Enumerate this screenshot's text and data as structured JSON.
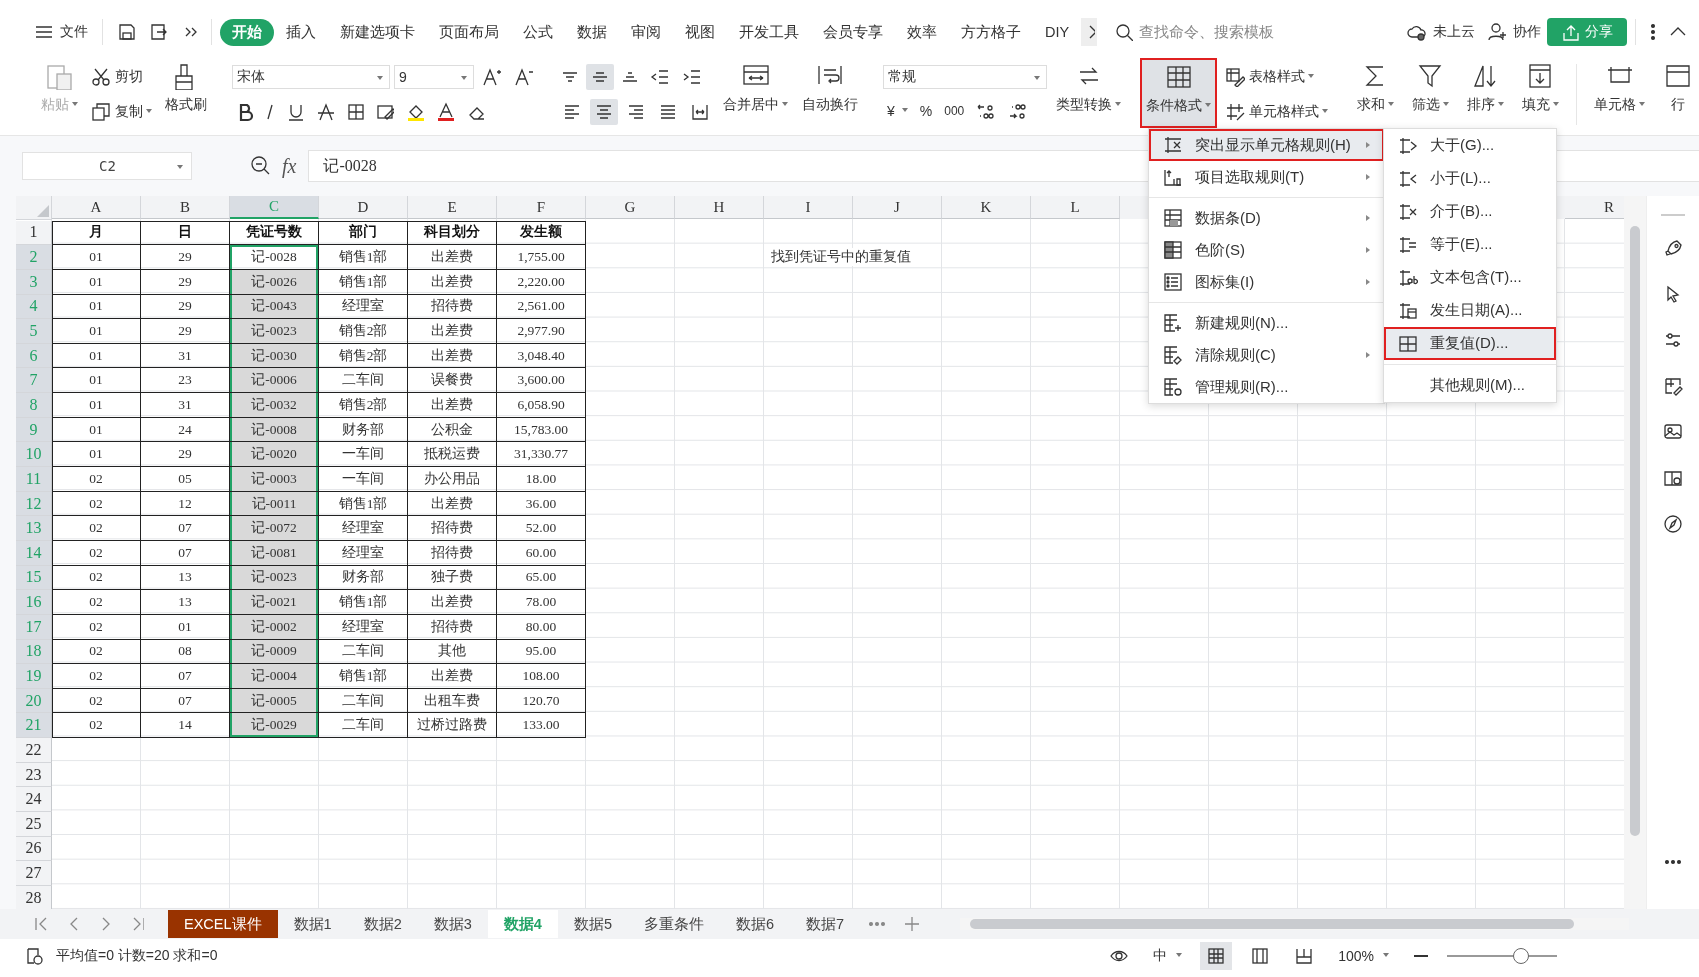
{
  "top_bar": {
    "file_menu": "文件",
    "tabs": [
      {
        "label": "开始",
        "selected": true
      },
      {
        "label": "插入",
        "selected": false
      },
      {
        "label": "新建选项卡",
        "selected": false
      },
      {
        "label": "页面布局",
        "selected": false
      },
      {
        "label": "公式",
        "selected": false
      },
      {
        "label": "数据",
        "selected": false
      },
      {
        "label": "审阅",
        "selected": false
      },
      {
        "label": "视图",
        "selected": false
      },
      {
        "label": "开发工具",
        "selected": false
      },
      {
        "label": "会员专享",
        "selected": false
      },
      {
        "label": "效率",
        "selected": false
      },
      {
        "label": "方方格子",
        "selected": false
      },
      {
        "label": "DIY",
        "selected": false
      }
    ],
    "search": {
      "placeholder": "查找命令、搜索模板"
    },
    "cloud": "未上云",
    "collaborate": "协作",
    "share": "分享"
  },
  "ribbon": {
    "clipboard": {
      "paste": {
        "label": "粘贴",
        "disabled": true,
        "dropdown": true
      },
      "cut": {
        "label": "剪切",
        "dropdown": false
      },
      "copy": {
        "label": "复制",
        "dropdown": true
      },
      "format_painter": {
        "label": "格式刷",
        "dropdown": false
      }
    },
    "font": {
      "name": "宋体",
      "size": "9"
    },
    "alignment": {
      "vertical": [
        {
          "selected": false
        },
        {
          "selected": true
        },
        {
          "selected": false
        }
      ],
      "horizontal": [
        {
          "selected": false
        },
        {
          "selected": true
        },
        {
          "selected": false
        },
        {
          "selected": false
        }
      ],
      "merge": {
        "label": "合并居中",
        "dropdown": true
      },
      "wrap": {
        "label": "自动换行",
        "dropdown": false
      }
    },
    "number": {
      "format": "常规",
      "currency": "¥",
      "percent": "%",
      "thousands": "000",
      "convert": {
        "label": "类型转换",
        "dropdown": true
      }
    },
    "styles": {
      "conditional_format": {
        "label": "条件格式",
        "dropdown": true,
        "selected": true,
        "boxed": true
      },
      "table_style": {
        "label": "表格样式",
        "dropdown": true
      },
      "cell_style": {
        "label": "单元格样式",
        "dropdown": true
      }
    },
    "editing": [
      {
        "label": "求和",
        "dropdown": true
      },
      {
        "label": "筛选",
        "dropdown": true
      },
      {
        "label": "排序",
        "dropdown": true
      },
      {
        "label": "填充",
        "dropdown": true
      },
      {
        "label": "单元格",
        "dropdown": true
      },
      {
        "label": "行",
        "dropdown": false
      }
    ]
  },
  "formula_bar": {
    "cell_ref": "C2",
    "fx": "fx",
    "value": "记-0028"
  },
  "sheet": {
    "columns": [
      {
        "label": "A",
        "selected": false
      },
      {
        "label": "B",
        "selected": false
      },
      {
        "label": "C",
        "selected": true
      },
      {
        "label": "D",
        "selected": false
      },
      {
        "label": "E",
        "selected": false
      },
      {
        "label": "F",
        "selected": false
      },
      {
        "label": "G",
        "selected": false
      },
      {
        "label": "H",
        "selected": false
      },
      {
        "label": "I",
        "selected": false
      },
      {
        "label": "J",
        "selected": false
      },
      {
        "label": "K",
        "selected": false
      },
      {
        "label": "L",
        "selected": false
      },
      null,
      null,
      null,
      null,
      null,
      {
        "label": "R",
        "selected": false
      }
    ],
    "rows": [
      {
        "number": "1",
        "selected": false,
        "kind": "header",
        "cells": [
          "月",
          "日",
          "凭证号数",
          "部门",
          "科目划分",
          "发生额"
        ]
      },
      {
        "number": "2",
        "selected": true,
        "active": true,
        "cells": [
          "01",
          "29",
          "记-0028",
          "销售1部",
          "出差费",
          "1,755.00"
        ],
        "note": "找到凭证号中的重复值"
      },
      {
        "number": "3",
        "selected": true,
        "cells": [
          "01",
          "29",
          "记-0026",
          "销售1部",
          "出差费",
          "2,220.00"
        ]
      },
      {
        "number": "4",
        "selected": true,
        "cells": [
          "01",
          "29",
          "记-0043",
          "经理室",
          "招待费",
          "2,561.00"
        ]
      },
      {
        "number": "5",
        "selected": true,
        "cells": [
          "01",
          "29",
          "记-0023",
          "销售2部",
          "出差费",
          "2,977.90"
        ]
      },
      {
        "number": "6",
        "selected": true,
        "cells": [
          "01",
          "31",
          "记-0030",
          "销售2部",
          "出差费",
          "3,048.40"
        ]
      },
      {
        "number": "7",
        "selected": true,
        "cells": [
          "01",
          "23",
          "记-0006",
          "二车间",
          "误餐费",
          "3,600.00"
        ]
      },
      {
        "number": "8",
        "selected": true,
        "cells": [
          "01",
          "31",
          "记-0032",
          "销售2部",
          "出差费",
          "6,058.90"
        ]
      },
      {
        "number": "9",
        "selected": true,
        "cells": [
          "01",
          "24",
          "记-0008",
          "财务部",
          "公积金",
          "15,783.00"
        ]
      },
      {
        "number": "10",
        "selected": true,
        "cells": [
          "01",
          "29",
          "记-0020",
          "一车间",
          "抵税运费",
          "31,330.77"
        ]
      },
      {
        "number": "11",
        "selected": true,
        "cells": [
          "02",
          "05",
          "记-0003",
          "一车间",
          "办公用品",
          "18.00"
        ]
      },
      {
        "number": "12",
        "selected": true,
        "cells": [
          "02",
          "12",
          "记-0011",
          "销售1部",
          "出差费",
          "36.00"
        ]
      },
      {
        "number": "13",
        "selected": true,
        "cells": [
          "02",
          "07",
          "记-0072",
          "经理室",
          "招待费",
          "52.00"
        ]
      },
      {
        "number": "14",
        "selected": true,
        "cells": [
          "02",
          "07",
          "记-0081",
          "经理室",
          "招待费",
          "60.00"
        ]
      },
      {
        "number": "15",
        "selected": true,
        "cells": [
          "02",
          "13",
          "记-0023",
          "财务部",
          "独子费",
          "65.00"
        ]
      },
      {
        "number": "16",
        "selected": true,
        "cells": [
          "02",
          "13",
          "记-0021",
          "销售1部",
          "出差费",
          "78.00"
        ]
      },
      {
        "number": "17",
        "selected": true,
        "cells": [
          "02",
          "01",
          "记-0002",
          "经理室",
          "招待费",
          "80.00"
        ]
      },
      {
        "number": "18",
        "selected": true,
        "cells": [
          "02",
          "08",
          "记-0009",
          "二车间",
          "其他",
          "95.00"
        ]
      },
      {
        "number": "19",
        "selected": true,
        "cells": [
          "02",
          "07",
          "记-0004",
          "销售1部",
          "出差费",
          "108.00"
        ]
      },
      {
        "number": "20",
        "selected": true,
        "cells": [
          "02",
          "07",
          "记-0005",
          "二车间",
          "出租车费",
          "120.70"
        ]
      },
      {
        "number": "21",
        "selected": true,
        "cells": [
          "02",
          "14",
          "记-0029",
          "二车间",
          "过桥过路费",
          "133.00"
        ]
      },
      {
        "number": "22",
        "selected": false
      },
      {
        "number": "23",
        "selected": false
      },
      {
        "number": "24",
        "selected": false
      },
      {
        "number": "25",
        "selected": false
      },
      {
        "number": "26",
        "selected": false
      },
      {
        "number": "27",
        "selected": false
      },
      {
        "number": "28",
        "selected": false
      }
    ]
  },
  "context_menu": {
    "groups": [
      [
        {
          "label": "突出显示单元格规则(H)",
          "submenu": true,
          "selected": true,
          "boxed": true
        },
        {
          "label": "项目选取规则(T)",
          "submenu": true,
          "selected": false,
          "boxed": false
        }
      ],
      [
        {
          "label": "数据条(D)",
          "submenu": true,
          "selected": false,
          "boxed": false
        },
        {
          "label": "色阶(S)",
          "submenu": true,
          "selected": false,
          "boxed": false
        },
        {
          "label": "图标集(I)",
          "submenu": true,
          "selected": false,
          "boxed": false
        }
      ],
      [
        {
          "label": "新建规则(N)...",
          "submenu": false,
          "selected": false,
          "boxed": false
        },
        {
          "label": "清除规则(C)",
          "submenu": true,
          "selected": false,
          "boxed": false
        },
        {
          "label": "管理规则(R)...",
          "submenu": false,
          "selected": false,
          "boxed": false
        }
      ]
    ]
  },
  "submenu": {
    "groups": [
      [
        {
          "label": "大于(G)...",
          "selected": false,
          "boxed": false
        },
        {
          "label": "小于(L)...",
          "selected": false,
          "boxed": false
        },
        {
          "label": "介于(B)...",
          "selected": false,
          "boxed": false
        },
        {
          "label": "等于(E)...",
          "selected": false,
          "boxed": false
        },
        {
          "label": "文本包含(T)...",
          "selected": false,
          "boxed": false
        },
        {
          "label": "发生日期(A)...",
          "selected": false,
          "boxed": false
        },
        {
          "label": "重复值(D)...",
          "selected": true,
          "boxed": true
        }
      ],
      [
        {
          "label": "其他规则(M)...",
          "selected": false,
          "boxed": false
        }
      ]
    ]
  },
  "sheet_tabs": [
    {
      "label": "EXCEL课件",
      "selected": false,
      "color": "#993300"
    },
    {
      "label": "数据1",
      "selected": false
    },
    {
      "label": "数据2",
      "selected": false
    },
    {
      "label": "数据3",
      "selected": false
    },
    {
      "label": "数据4",
      "selected": true
    },
    {
      "label": "数据5",
      "selected": false
    },
    {
      "label": "多重条件",
      "selected": false
    },
    {
      "label": "数据6",
      "selected": false
    },
    {
      "label": "数据7",
      "selected": false
    }
  ],
  "status_bar": {
    "summary": "平均值=0 计数=20 求和=0",
    "input_mode": "中",
    "zoom": "100%",
    "zoom_slider": {
      "level": 0.66
    }
  }
}
